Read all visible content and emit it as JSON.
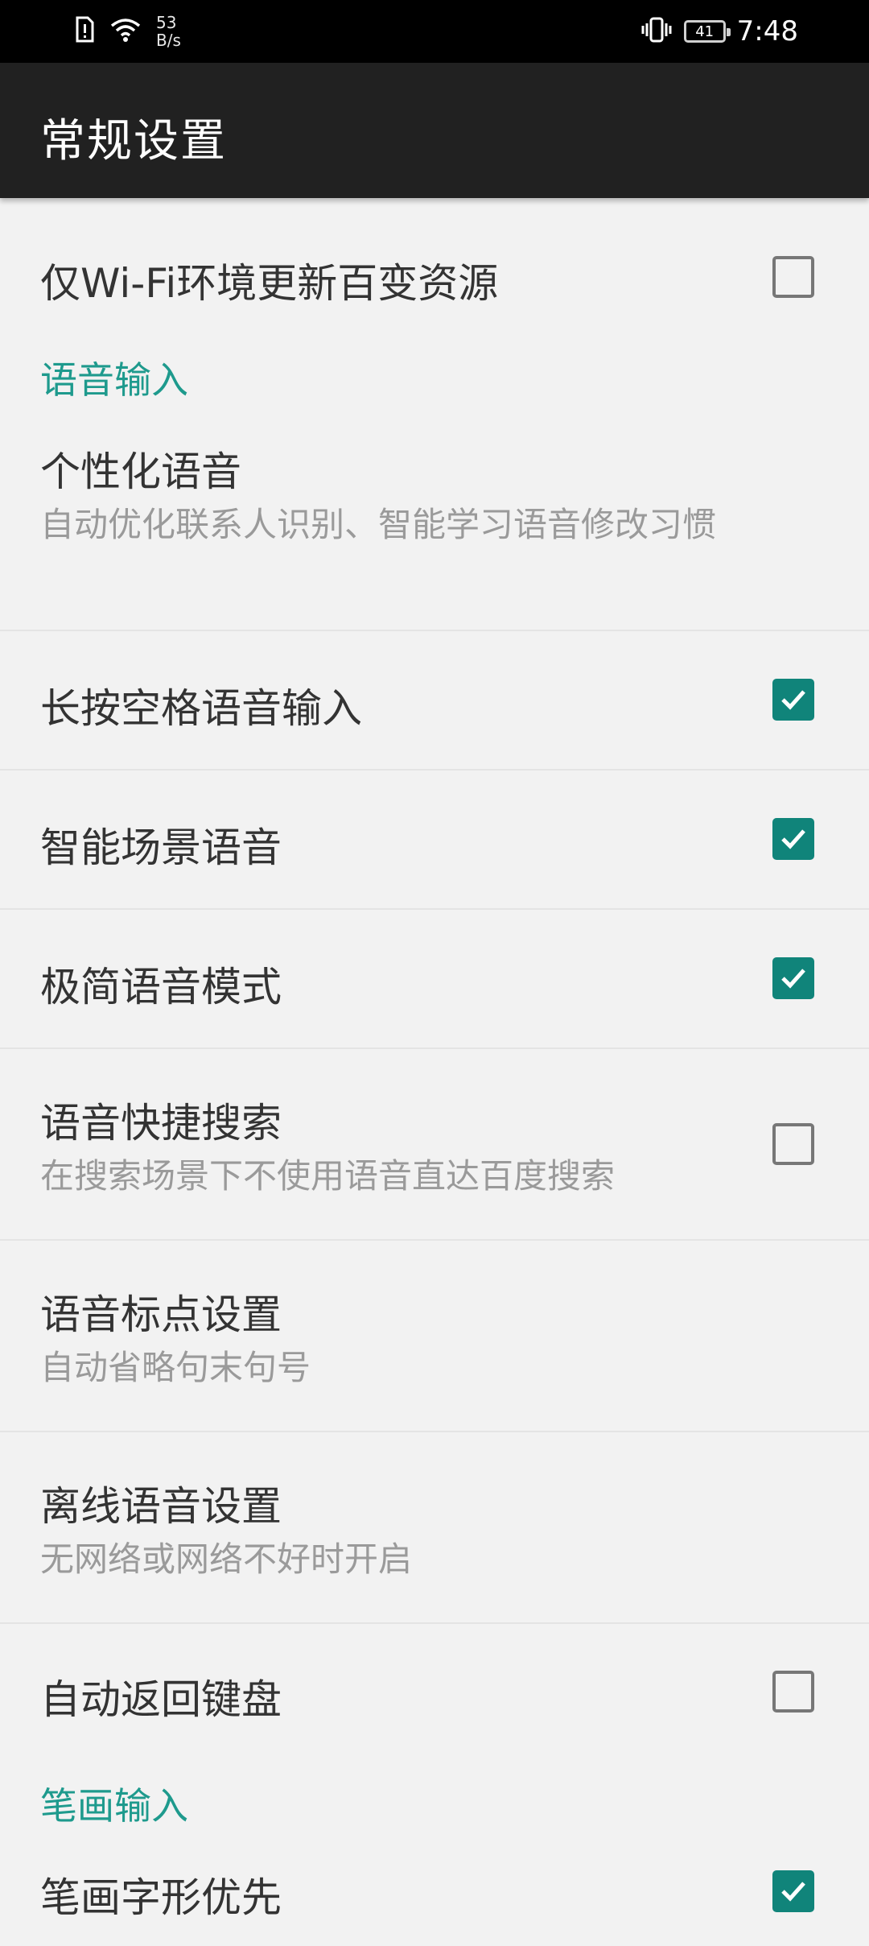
{
  "status_bar": {
    "net_speed_value": "53",
    "net_speed_unit": "B/s",
    "battery_level": "41",
    "time": "7:48"
  },
  "app_bar": {
    "title": "常规设置"
  },
  "rows": {
    "wifi_update": {
      "title": "仅Wi-Fi环境更新百变资源",
      "checked": false
    },
    "voice_section": {
      "label": "语音输入"
    },
    "personal_voice": {
      "title": "个性化语音",
      "subtitle": "自动优化联系人识别、智能学习语音修改习惯"
    },
    "long_press_space": {
      "title": "长按空格语音输入",
      "checked": true
    },
    "smart_scene": {
      "title": "智能场景语音",
      "checked": true
    },
    "minimal_mode": {
      "title": "极简语音模式",
      "checked": true
    },
    "voice_search": {
      "title": "语音快捷搜索",
      "subtitle": "在搜索场景下不使用语音直达百度搜索",
      "checked": false
    },
    "punctuation": {
      "title": "语音标点设置",
      "subtitle": "自动省略句末句号"
    },
    "offline_voice": {
      "title": "离线语音设置",
      "subtitle": "无网络或网络不好时开启"
    },
    "auto_return": {
      "title": "自动返回键盘",
      "checked": false
    },
    "stroke_section": {
      "label": "笔画输入"
    },
    "stroke_priority": {
      "title": "笔画字形优先",
      "checked": true
    }
  },
  "colors": {
    "accent": "#1e9a8d",
    "checkbox_checked": "#10847a",
    "app_bar": "#212121",
    "background": "#f2f2f2"
  }
}
